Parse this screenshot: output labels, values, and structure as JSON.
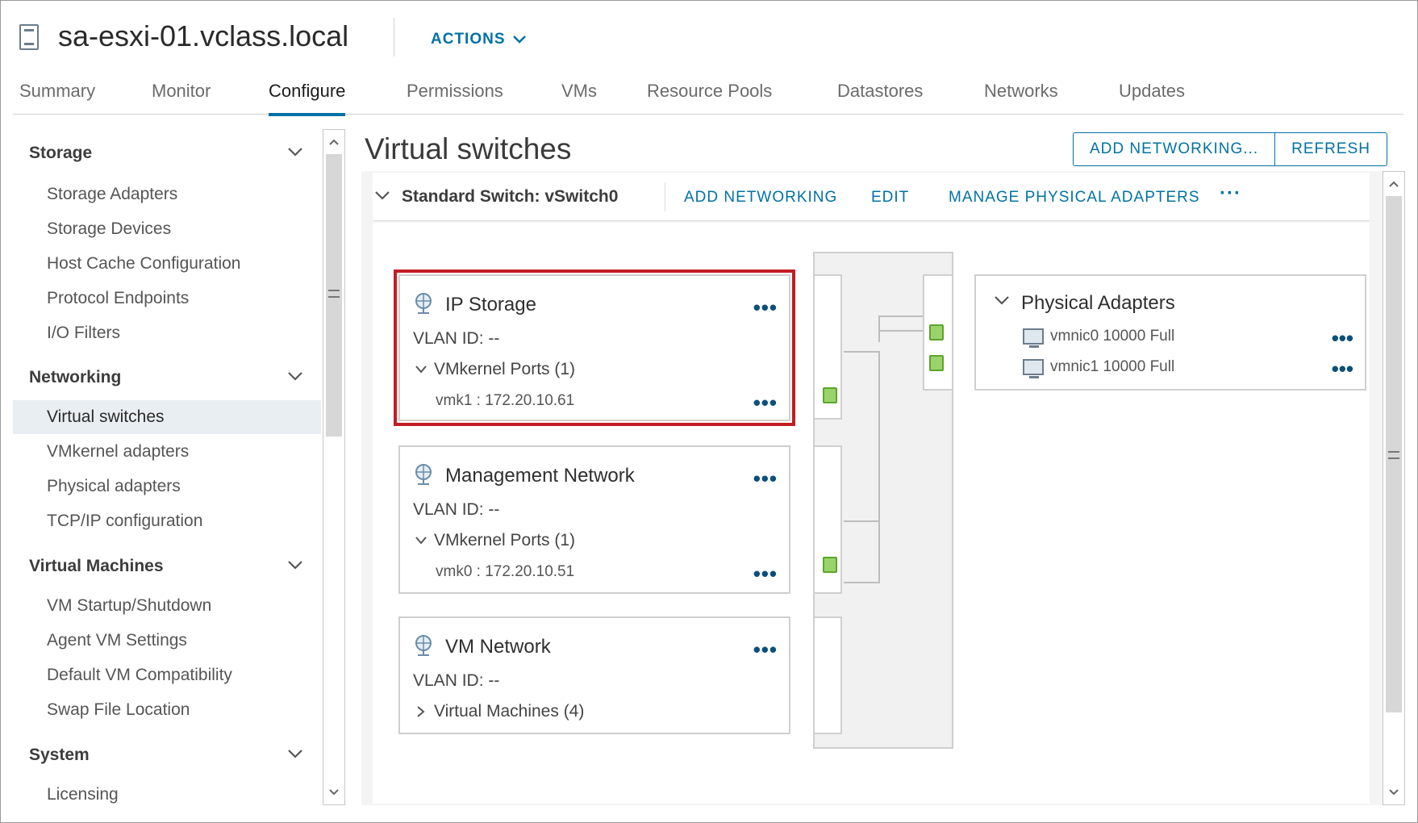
{
  "header": {
    "host_name": "sa-esxi-01.vclass.local",
    "actions_label": "ACTIONS"
  },
  "tabs": [
    {
      "label": "Summary"
    },
    {
      "label": "Monitor"
    },
    {
      "label": "Configure",
      "active": true
    },
    {
      "label": "Permissions"
    },
    {
      "label": "VMs"
    },
    {
      "label": "Resource Pools"
    },
    {
      "label": "Datastores"
    },
    {
      "label": "Networks"
    },
    {
      "label": "Updates"
    }
  ],
  "nav": {
    "groups": [
      {
        "label": "Storage",
        "items": [
          "Storage Adapters",
          "Storage Devices",
          "Host Cache Configuration",
          "Protocol Endpoints",
          "I/O Filters"
        ]
      },
      {
        "label": "Networking",
        "items": [
          "Virtual switches",
          "VMkernel adapters",
          "Physical adapters",
          "TCP/IP configuration"
        ]
      },
      {
        "label": "Virtual Machines",
        "items": [
          "VM Startup/Shutdown",
          "Agent VM Settings",
          "Default VM Compatibility",
          "Swap File Location"
        ]
      },
      {
        "label": "System",
        "items": [
          "Licensing"
        ]
      }
    ],
    "selected_item": "Virtual switches"
  },
  "main": {
    "title": "Virtual switches",
    "add_networking_button": "ADD NETWORKING...",
    "refresh_button": "REFRESH"
  },
  "switch": {
    "name": "Standard Switch: vSwitch0",
    "add_networking_link": "ADD NETWORKING",
    "edit_link": "EDIT",
    "manage_adapters_link": "MANAGE PHYSICAL ADAPTERS",
    "more": "···"
  },
  "port_groups": [
    {
      "name": "IP Storage",
      "vlan": "VLAN ID: --",
      "ports_label": "VMkernel Ports (1)",
      "vmk": "vmk1 : 172.20.10.61",
      "highlighted": true
    },
    {
      "name": "Management Network",
      "vlan": "VLAN ID: --",
      "ports_label": "VMkernel Ports (1)",
      "vmk": "vmk0 : 172.20.10.51"
    },
    {
      "name": "VM Network",
      "vlan": "VLAN ID: --",
      "ports_label": "Virtual Machines (4)"
    }
  ],
  "physical_adapters": {
    "title": "Physical Adapters",
    "items": [
      "vmnic0 10000 Full",
      "vmnic1 10000 Full"
    ]
  },
  "dots": "•••",
  "colors": {
    "accent": "#0072a3",
    "highlight": "#c21d24",
    "port_green": "#9bd36b"
  }
}
